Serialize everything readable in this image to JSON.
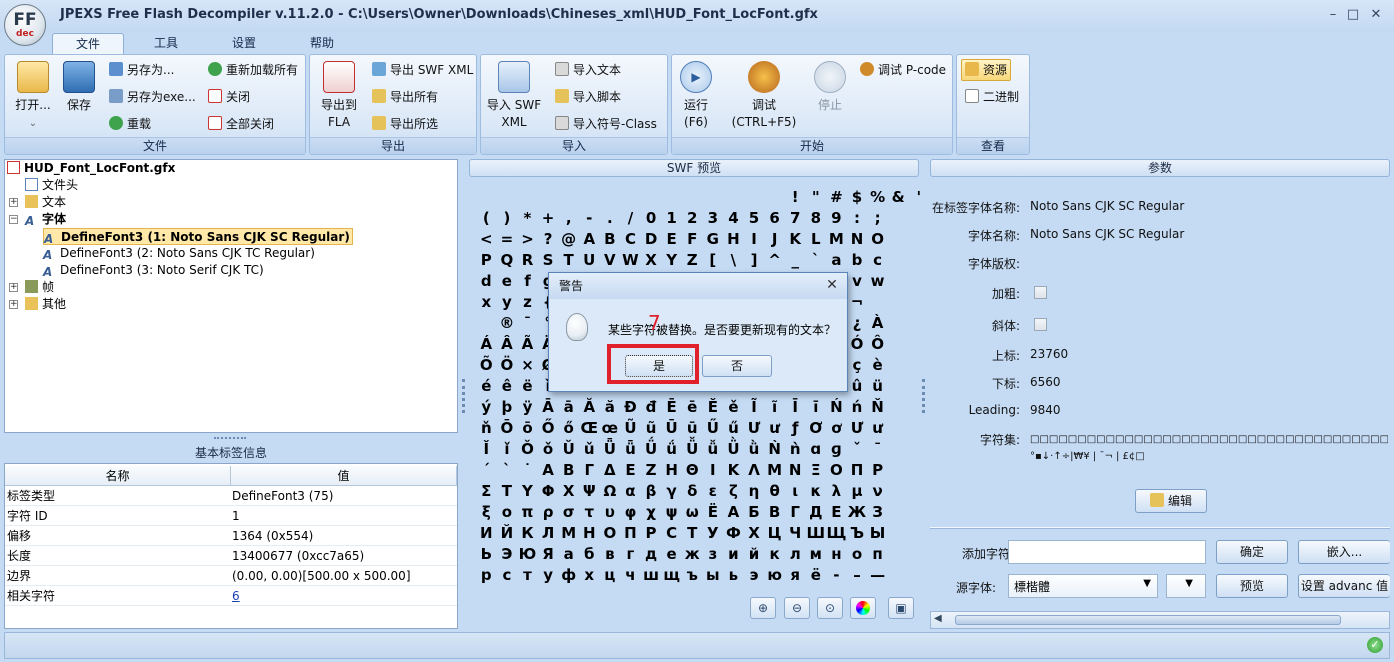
{
  "window": {
    "logo_text": "FF",
    "logo_sub": "dec",
    "title": "JPEXS Free Flash Decompiler v.11.2.0 - C:\\Users\\Owner\\Downloads\\Chineses_xml\\HUD_Font_LocFont.gfx",
    "controls": [
      "–",
      "□",
      "✕"
    ]
  },
  "menu_tabs": [
    "文件",
    "工具",
    "设置",
    "帮助"
  ],
  "ribbon": {
    "file": {
      "label": "文件",
      "open": "打开...",
      "save": "保存",
      "save_as": "另存为...",
      "save_as_exe": "另存为exe...",
      "reload": "重载",
      "reload_all": "重新加载所有",
      "close": "关闭",
      "close_all": "全部关闭"
    },
    "export": {
      "label": "导出",
      "export_fla_1": "导出到",
      "export_fla_2": "FLA",
      "export_swf_xml": "导出 SWF XML",
      "export_all": "导出所有",
      "export_selected": "导出所选"
    },
    "import": {
      "label": "导入",
      "import_swf_xml_1": "导入 SWF",
      "import_swf_xml_2": "XML",
      "import_text": "导入文本",
      "import_script": "导入脚本",
      "import_symbol_class": "导入符号-Class"
    },
    "start": {
      "label": "开始",
      "run_1": "运行",
      "run_2": "(F6)",
      "debug_1": "调试",
      "debug_2": "(CTRL+F5)",
      "stop": "停止",
      "debug_pcode": "调试 P-code"
    },
    "view": {
      "label": "查看",
      "resources": "资源",
      "binary": "二进制"
    }
  },
  "tree": {
    "root": "HUD_Font_LocFont.gfx",
    "items": [
      "文件头",
      "文本",
      "字体",
      "DefineFont3 (1: Noto Sans CJK SC Regular)",
      "DefineFont3 (2: Noto Sans CJK TC Regular)",
      "DefineFont3 (3: Noto Serif CJK TC)",
      "帧",
      "其他"
    ]
  },
  "basic_info": {
    "title": "基本标签信息",
    "columns": [
      "名称",
      "值"
    ],
    "rows": [
      [
        "标签类型",
        "DefineFont3 (75)"
      ],
      [
        "字符 ID",
        "1"
      ],
      [
        "偏移",
        "1364 (0x554)"
      ],
      [
        "长度",
        "13400677 (0xcc7a65)"
      ],
      [
        "边界",
        "(0.00, 0.00)[500.00 x 500.00]"
      ],
      [
        "相关字符",
        "6"
      ]
    ]
  },
  "preview": {
    "title": "SWF 预览",
    "glyph_rows": [
      "               ! \" # $ % & '",
      "( ) * + , - . / 0 1 2 3 4 5 6 7 8 9 : ;",
      "< = > ? @ A B C D E F G H I J K L M N O",
      "P Q R S T U V W X Y Z [ \\ ] ^ _ ` a b c",
      "d e f g h i j k l m n o p q r s t u v w",
      "x y z { | } ~ ¡ ¢ £ ¤ ¥ ¦ § ¨ © ª « ¬",
      "­ ® ¯ ° ± ² ³ ´ µ ¶ · ¸ ¹ º » ¼ ½ ¾ ¿ À",
      "Á Â Ã Ä Å Æ Ç È É Ê Ë Ì Í Î Ï Ð Ñ Ò Ó Ô",
      "Õ Ö × Ø Ù Ú Û Ü Ý Þ ß à á â ã ä å æ ç è",
      "é ê ë ì í î ï ð ñ ò ó ô õ ö ÷ ø ù ú û ü",
      "ý þ ÿ Ā ā Ă ă Đ đ Ē ē Ě ě Ĩ ĩ Ī ī Ń ń Ň",
      "ň Ō ō Ő ő Œ œ Ũ ũ Ū ū Ű ű Ư ư ƒ Ơ ơ Ư ư",
      "Ǐ ǐ Ǒ ǒ Ǔ ǔ Ǖ ǖ Ǘ ǘ Ǚ ǚ Ǜ ǜ Ǹ ǹ ɑ ɡ ˇ ˉ",
      "ˊ ˋ ˙ Α Β Γ Δ Ε Ζ Η Θ Ι Κ Λ Μ Ν Ξ Ο Π Ρ",
      "Σ Τ Υ Φ Χ Ψ Ω α β γ δ ε ζ η θ ι κ λ μ ν",
      "ξ ο π ρ σ τ υ φ χ ψ ω Ё А Б В Г Д Е Ж З",
      "И Й К Л М Н О П Р С Т У Ф Х Ц Ч Ш Щ Ъ Ы",
      "Ь Э Ю Я а б в г д е ж з и й к л м н о п",
      "р с т у ф х ц ч ш щ ъ ы ь э ю я ё ‐ – —"
    ],
    "tools": [
      "zoom-in-icon",
      "zoom-out-icon",
      "zoom-fit-icon",
      "color-wheel-icon",
      "camera-icon"
    ]
  },
  "params": {
    "title": "参数",
    "in_tag_font_name_label": "在标签字体名称:",
    "in_tag_font_name": "Noto Sans CJK SC Regular",
    "font_name_label": "字体名称:",
    "font_name": "Noto Sans CJK SC Regular",
    "copyright_label": "字体版权:",
    "bold_label": "加粗:",
    "italic_label": "斜体:",
    "ascent_label": "上标:",
    "ascent": "23760",
    "descent_label": "下标:",
    "descent": "6560",
    "leading_label": "Leading:",
    "leading": "9840",
    "charset_label": "字符集:",
    "charset_line1": "□□□□□□□□□□□□□□□□□□□□□□□□□□□□□□□□□□□□□□□□□□□□□□□□□□□□",
    "charset_line2": "°▪↓·↑÷|₩¥ | ¯¬ | £¢□",
    "edit_button": "编辑",
    "add_chars_label": "添加字符集:",
    "add_chars_value": "",
    "confirm_button": "确定",
    "embed_button": "嵌入...",
    "source_font_label": "源字体:",
    "source_font_value": "標楷體",
    "preview_button": "预览",
    "advance_button": "设置 advanc 值"
  },
  "dialog": {
    "title": "警告",
    "message": "某些字符被替换。是否要更新现有的文本？",
    "yes": "是",
    "no": "否",
    "annotation": "7"
  },
  "colors": {
    "accent": "#c5dbf4",
    "highlight": "#e0202a",
    "selection": "#ffe8a8"
  }
}
